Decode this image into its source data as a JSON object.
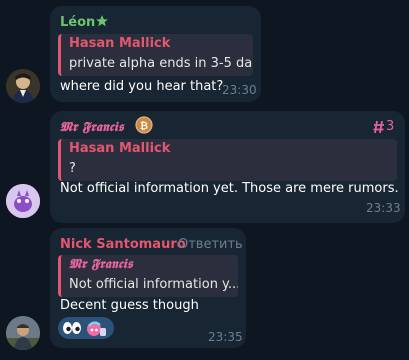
{
  "messages": [
    {
      "sender": "Léon",
      "sender_color": "#6ec46e",
      "badge_icon": "star-icon",
      "reply": {
        "name": "Hasan Mallick",
        "text": "private alpha ends in 3-5 da..."
      },
      "text": "where did you hear that?",
      "time": "23:30"
    },
    {
      "sender": "𝕸𝖗 𝕱𝖗𝖆𝖓𝖈𝖎𝖘",
      "sender_color": "#e36498",
      "badge_icon": "bitcoin-icon",
      "rank": "3",
      "rank_icon": "hashtag-icon",
      "reply": {
        "name": "Hasan Mallick",
        "text": "?"
      },
      "text": "Not official information yet. Those are mere rumors.",
      "time": "23:33"
    },
    {
      "sender": "Nick Santomauro",
      "sender_color": "#e4566f",
      "action": "Ответить",
      "reply": {
        "name": "𝕸𝖗 𝕱𝖗𝖆𝖓𝖈𝖎𝖘",
        "text": "Not official information y..."
      },
      "text": "Decent guess though",
      "reactions": [
        "eyes-emoji",
        "sticker-reaction"
      ],
      "time": "23:35"
    }
  ]
}
